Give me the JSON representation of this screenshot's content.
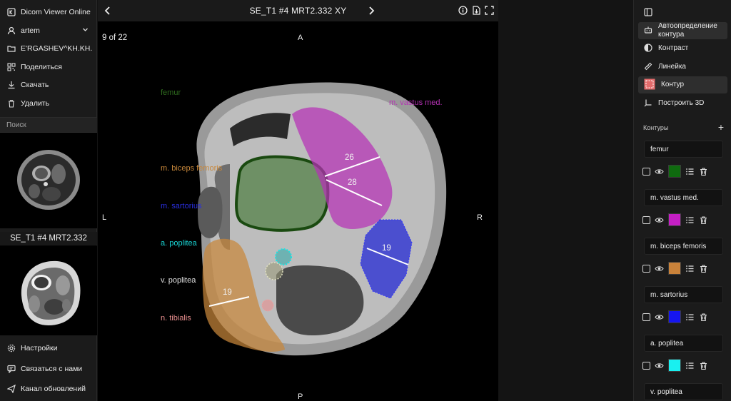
{
  "app": {
    "title": "Dicom Viewer Online"
  },
  "left_menu": {
    "user": "artem",
    "patient": "E'RGASHEV^KH.KH.",
    "share": "Поделиться",
    "download": "Скачать",
    "delete": "Удалить",
    "search_placeholder": "Поиск",
    "series_label": "SE_T1 #4 MRT2.332",
    "settings": "Настройки",
    "contact": "Связаться с нами",
    "updates": "Канал обновлений"
  },
  "viewer": {
    "title": "SE_T1 #4 MRT2.332 XY",
    "slice_counter": "9 of 22",
    "orient_top": "A",
    "orient_bottom": "P",
    "orient_left": "L",
    "orient_right": "R",
    "labels": {
      "femur": "femur",
      "vastus": "m. vastus med.",
      "biceps": "m. biceps femoris",
      "sartorius": "m. sartorius",
      "poplitea_a": "a. poplitea",
      "poplitea_v": "v. poplitea",
      "tibialis": "n. tibialis"
    },
    "measurements": {
      "m1": "26",
      "m2": "28",
      "m3": "19",
      "m4": "19"
    },
    "colors": {
      "femur": "#2e6b1e",
      "vastus": "#b531b5",
      "biceps": "#c8873a",
      "sartorius": "#1f24d6",
      "poplitea_a": "#18d4d4",
      "poplitea_v": "#d8d8b0",
      "tibialis": "#e88e8e"
    }
  },
  "tools": {
    "auto_contour": "Автоопределение контура",
    "contrast": "Контраст",
    "ruler": "Линейка",
    "contour": "Контур",
    "build3d": "Построить 3D",
    "contours_header": "Контуры"
  },
  "contours": [
    {
      "name": "femur",
      "color": "#0f6b0f"
    },
    {
      "name": "m. vastus med.",
      "color": "#c51fc5"
    },
    {
      "name": "m. biceps femoris",
      "color": "#c9823a"
    },
    {
      "name": "m. sartorius",
      "color": "#1515f0"
    },
    {
      "name": "a. poplitea",
      "color": "#19f0f0"
    },
    {
      "name": "v. poplitea",
      "color": ""
    }
  ]
}
